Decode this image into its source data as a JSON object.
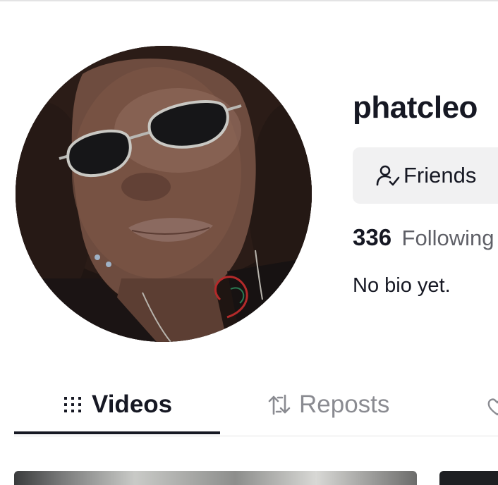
{
  "profile": {
    "username": "phatcleo",
    "friends_button": "Friends",
    "following_count": "336",
    "following_label": "Following",
    "bio": "No bio yet."
  },
  "tabs": [
    {
      "label": "Videos",
      "icon": "grid-icon",
      "selected": true
    },
    {
      "label": "Reposts",
      "icon": "repost-icon",
      "selected": false
    },
    {
      "label": "",
      "icon": "heart-icon",
      "selected": false
    }
  ],
  "colors": {
    "text_primary": "#161823",
    "text_secondary": "#5f6067",
    "tab_inactive": "#8a8b91",
    "button_bg": "#f1f1f2",
    "divider": "#e3e3e4"
  }
}
